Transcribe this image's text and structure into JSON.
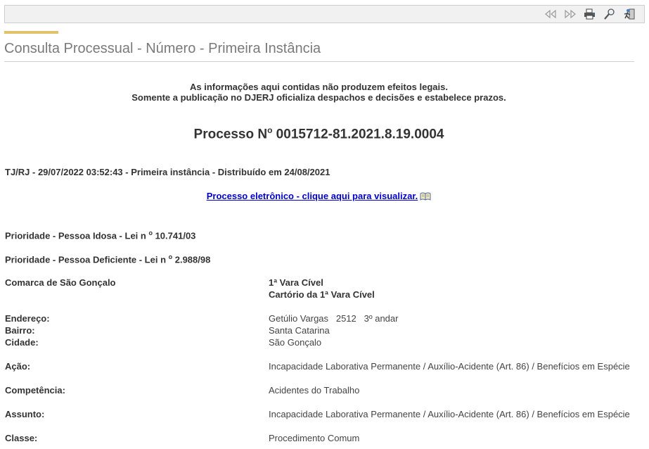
{
  "toolbar": {
    "icons": [
      "rewind-icon",
      "fast-forward-icon",
      "print-icon",
      "search-icon",
      "exit-icon"
    ]
  },
  "page": {
    "title": "Consulta Processual - Número - Primeira Instância"
  },
  "notice": {
    "line1": "As informações aqui contidas não produzem efeitos legais.",
    "line2": "Somente a publicação no DJERJ oficializa despachos e decisões e estabelece prazos."
  },
  "process": {
    "prefix": "Processo N",
    "ordinal": "o",
    "number": " 0015712-81.2021.8.19.0004",
    "distribution": "TJ/RJ - 29/07/2022 03:52:43 - Primeira instância - Distribuído em 24/08/2021",
    "electronic_link": "Processo eletrônico - clique aqui para visualizar."
  },
  "priorities": {
    "p1_text": "Prioridade - Pessoa Idosa - Lei n ",
    "p1_sup": "o",
    "p1_num": " 10.741/03",
    "p2_text": "Prioridade - Pessoa Deficiente - Lei n ",
    "p2_sup": "o",
    "p2_num": " 2.988/98"
  },
  "details": {
    "comarca_label": "Comarca de São Gonçalo",
    "vara": "1ª Vara Cível",
    "cartorio": "Cartório da 1ª Vara Cível",
    "endereco_label": "Endereço:",
    "endereco_value": "Getúlio Vargas   2512   3º andar",
    "bairro_label": "Bairro:",
    "bairro_value": "Santa Catarina",
    "cidade_label": "Cidade:",
    "cidade_value": "São Gonçalo",
    "acao_label": "Ação:",
    "acao_value": "Incapacidade Laborativa Permanente / Auxílio-Acidente (Art. 86) / Benefícios em Espécie",
    "competencia_label": "Competência:",
    "competencia_value": "Acidentes do Trabalho",
    "assunto_label": "Assunto:",
    "assunto_value": "Incapacidade Laborativa Permanente / Auxílio-Acidente (Art. 86) / Benefícios em Espécie",
    "classe_label": "Classe:",
    "classe_value": "Procedimento Comum"
  }
}
